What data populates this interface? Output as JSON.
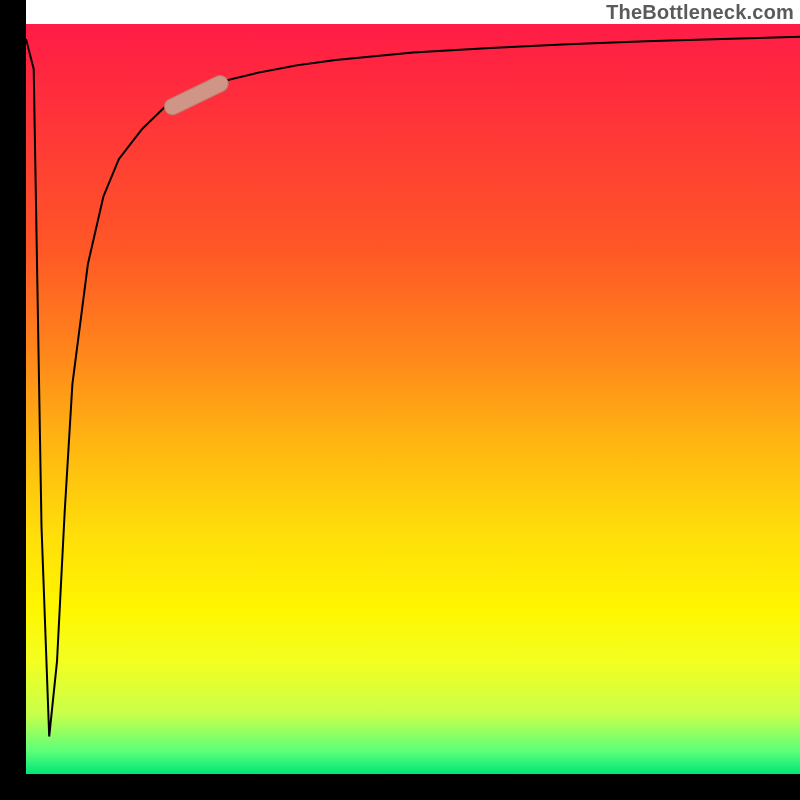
{
  "attribution": "TheBottleneck.com",
  "colors": {
    "frame": "#000000",
    "curve": "#000000",
    "highlight_fill": "#cf9587",
    "highlight_stroke": "#b9836f",
    "gradient_top": "#ff1c46",
    "gradient_mid": "#ffde0a",
    "gradient_bottom": "#00e676"
  },
  "chart_data": {
    "type": "line",
    "title": "",
    "xlabel": "",
    "ylabel": "",
    "x": [
      0.0,
      0.01,
      0.02,
      0.03,
      0.04,
      0.05,
      0.06,
      0.08,
      0.1,
      0.12,
      0.15,
      0.18,
      0.22,
      0.26,
      0.3,
      0.35,
      0.4,
      0.5,
      0.6,
      0.7,
      0.8,
      0.9,
      1.0
    ],
    "y": [
      0.98,
      0.94,
      0.33,
      0.05,
      0.15,
      0.35,
      0.52,
      0.68,
      0.77,
      0.82,
      0.86,
      0.89,
      0.91,
      0.925,
      0.935,
      0.945,
      0.952,
      0.962,
      0.968,
      0.973,
      0.977,
      0.98,
      0.983
    ],
    "xlim": [
      0,
      1
    ],
    "ylim": [
      0,
      1
    ],
    "highlight_segment": {
      "x0": 0.18,
      "y0": 0.885,
      "x1": 0.26,
      "y1": 0.925
    },
    "notes": "Curve values are estimated from the figure; y is fraction of plot height from bottom, x is fraction of plot width from left. The short salmon capsule on the curve marks the highlight_segment."
  }
}
